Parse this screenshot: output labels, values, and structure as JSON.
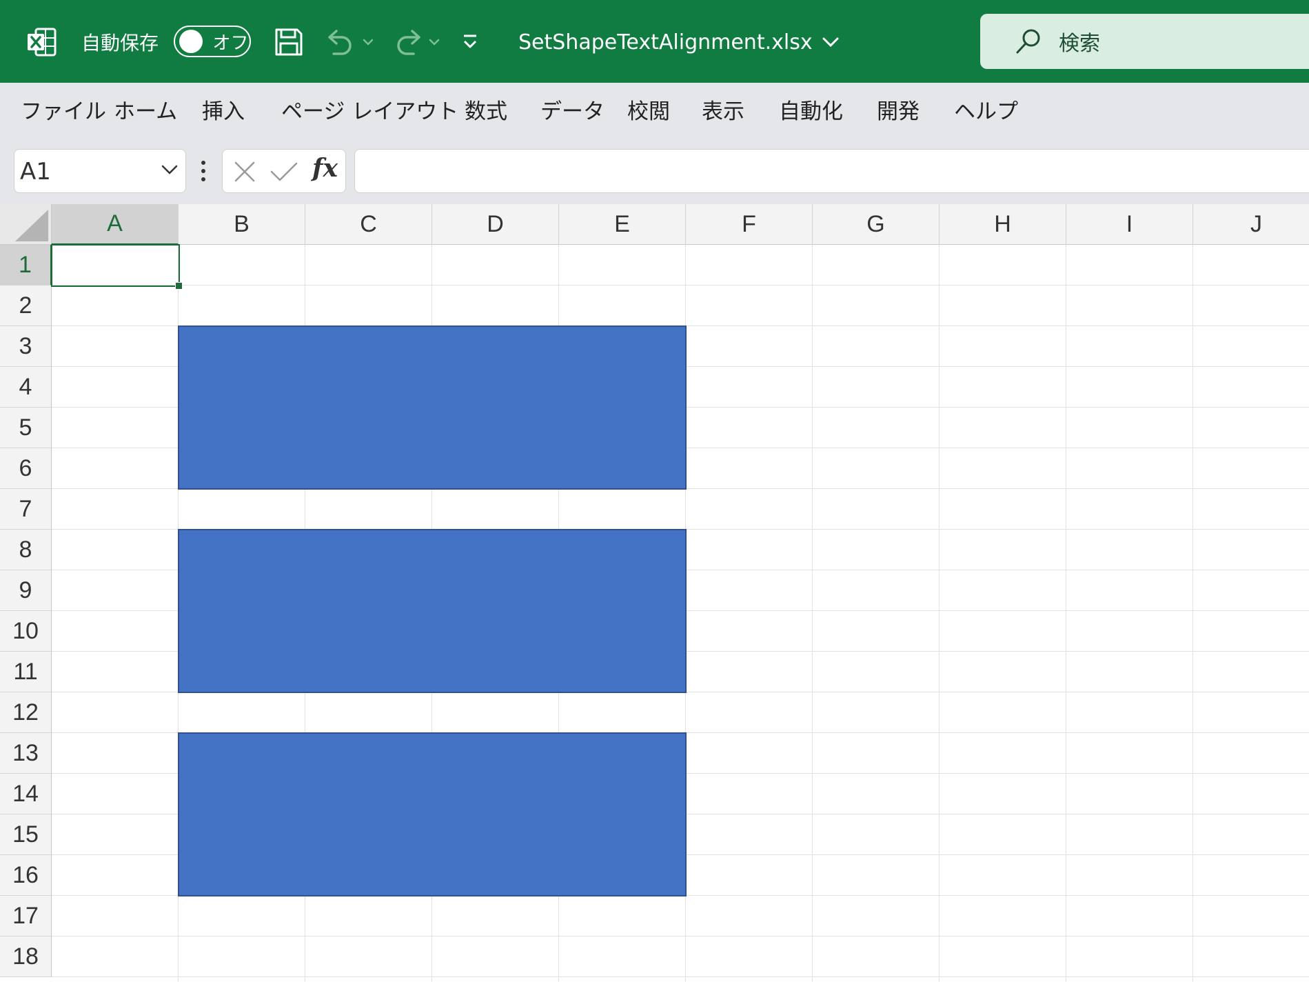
{
  "titlebar": {
    "autosave_label": "自動保存",
    "autosave_state": "オフ",
    "file_name": "SetShapeTextAlignment.xlsx",
    "search_placeholder": "検索",
    "icons": [
      "excel-app-icon",
      "save-icon",
      "undo-icon",
      "redo-icon",
      "customize-qat-icon",
      "chevron-down-icon",
      "search-icon"
    ],
    "accent_color": "#107c41"
  },
  "ribbon": {
    "tabs": [
      "ファイル",
      "ホーム",
      "挿入",
      "ページ レイアウト",
      "数式",
      "データ",
      "校閲",
      "表示",
      "自動化",
      "開発",
      "ヘルプ"
    ]
  },
  "formula_bar": {
    "name_box": "A1",
    "fx_label": "fx",
    "formula": ""
  },
  "sheet": {
    "columns": [
      "A",
      "B",
      "C",
      "D",
      "E",
      "F",
      "G",
      "H",
      "I",
      "J"
    ],
    "rows": [
      "1",
      "2",
      "3",
      "4",
      "5",
      "6",
      "7",
      "8",
      "9",
      "10",
      "11",
      "12",
      "13",
      "14",
      "15",
      "16",
      "17",
      "18"
    ],
    "active_cell": "A1",
    "shapes": [
      {
        "name": "rectangle-1",
        "range": "B3:E6",
        "fill": "#4472c4"
      },
      {
        "name": "rectangle-2",
        "range": "B8:E11",
        "fill": "#4472c4"
      },
      {
        "name": "rectangle-3",
        "range": "B13:E16",
        "fill": "#4472c4"
      }
    ]
  }
}
